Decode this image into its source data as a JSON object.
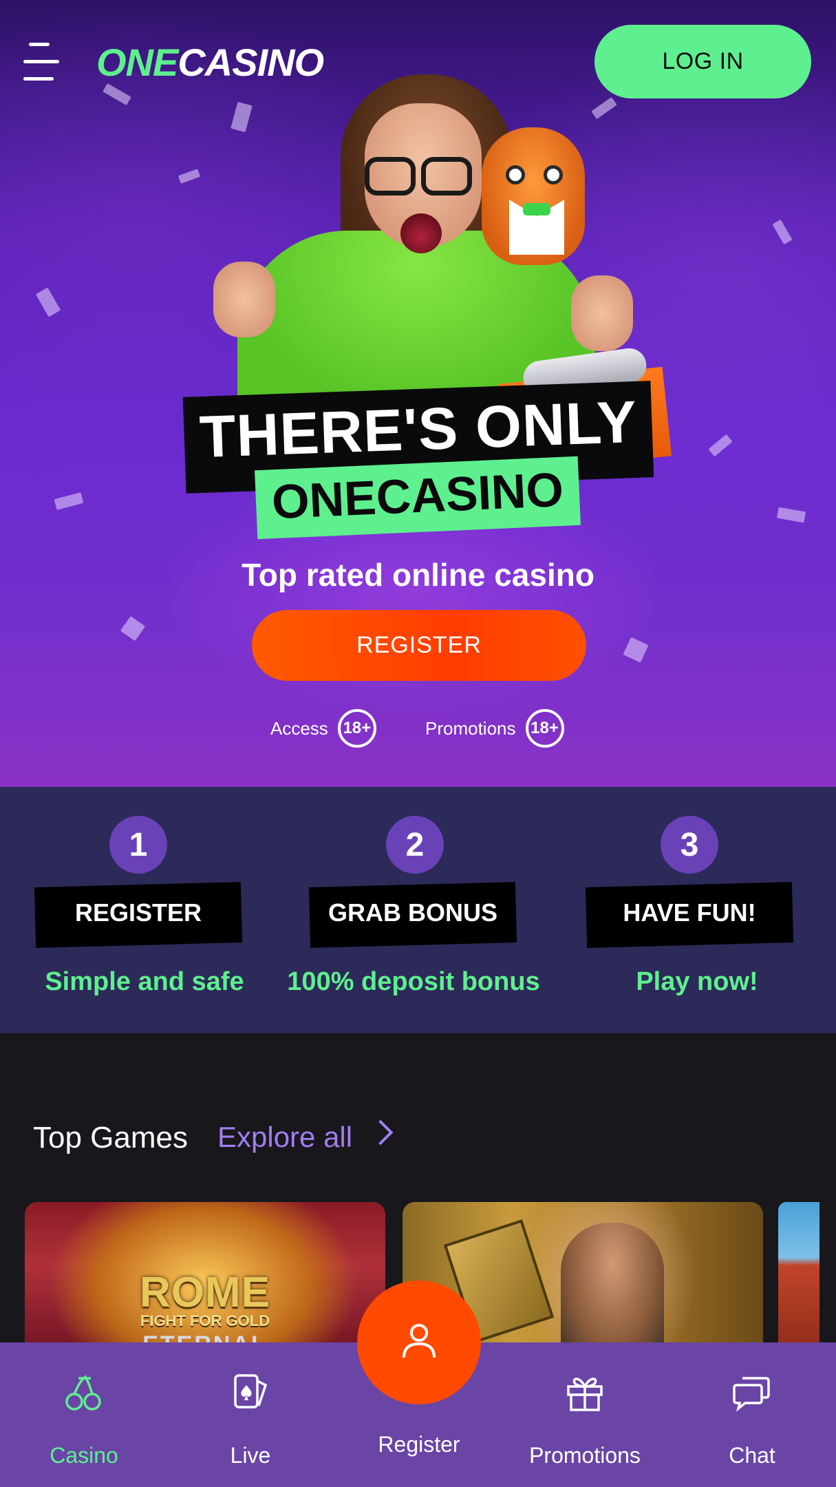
{
  "header": {
    "logo_prefix": "ONE",
    "logo_suffix": "CASINO",
    "login_label": "LOG IN"
  },
  "hero": {
    "headline_line1": "THERE'S ONLY",
    "headline_line2": "ONECASINO",
    "subtitle": "Top rated online casino",
    "register_label": "REGISTER",
    "badges": [
      {
        "label": "Access",
        "age": "18+"
      },
      {
        "label": "Promotions",
        "age": "18+"
      }
    ]
  },
  "steps": [
    {
      "number": "1",
      "label": "REGISTER",
      "sub": "Simple and safe"
    },
    {
      "number": "2",
      "label": "GRAB BONUS",
      "sub": "100% deposit bonus"
    },
    {
      "number": "3",
      "label": "HAVE FUN!",
      "sub": "Play now!"
    }
  ],
  "games": {
    "title": "Top Games",
    "explore_label": "Explore all",
    "cards": [
      {
        "title": "ROME",
        "subtitle": "FIGHT FOR GOLD",
        "subtitle2": "ETERNAL"
      },
      {
        "title": ""
      },
      {
        "title": ""
      }
    ]
  },
  "bottom_nav": {
    "items": [
      {
        "label": "Casino",
        "icon": "cherries-icon",
        "active": true
      },
      {
        "label": "Live",
        "icon": "playing-card-icon",
        "active": false
      },
      {
        "label": "Register",
        "icon": "user-icon",
        "active": false
      },
      {
        "label": "Promotions",
        "icon": "gift-icon",
        "active": false
      },
      {
        "label": "Chat",
        "icon": "chat-bubbles-icon",
        "active": false
      }
    ]
  },
  "colors": {
    "accent_green": "#5ef08e",
    "accent_orange": "#ff4a00",
    "steps_bg": "#2c2a58",
    "nav_bg": "#6a45a6",
    "link_purple": "#a27df0"
  }
}
